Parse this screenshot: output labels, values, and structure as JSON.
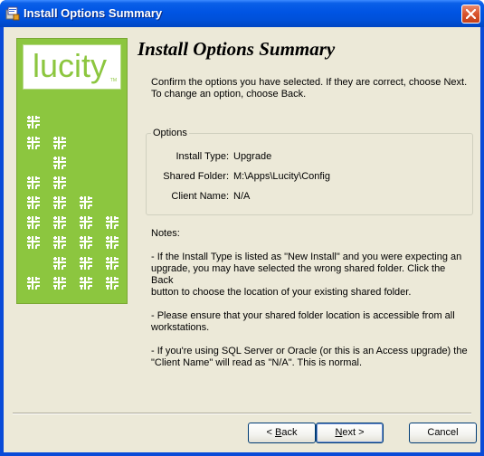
{
  "window": {
    "title": "Install Options Summary",
    "icon": "installer-icon"
  },
  "logo": {
    "text": "lucity",
    "tm": "TM",
    "accent_color": "#8cc63f"
  },
  "heading": "Install Options Summary",
  "intro_line1": "Confirm the options you have selected.  If they are correct, choose Next.",
  "intro_line2": "To change an option, choose Back.",
  "options": {
    "legend": "Options",
    "install_type_label": "Install Type:",
    "install_type_value": "Upgrade",
    "shared_folder_label": "Shared Folder:",
    "shared_folder_value": "M:\\Apps\\Lucity\\Config",
    "client_name_label": "Client Name:",
    "client_name_value": "N/A"
  },
  "notes": {
    "title": "Notes:",
    "note1_l1": " - If the Install Type is listed as \"New Install\" and you were expecting an",
    "note1_l2": "upgrade, you may have selected the wrong shared folder. Click the Back",
    "note1_l3": "button to choose the location of your existing shared folder.",
    "note2_l1": " - Please ensure that your shared folder location is accessible from all",
    "note2_l2": "workstations.",
    "note3_l1": " - If you're using SQL Server or Oracle (or this is an Access upgrade) the",
    "note3_l2": "\"Client Name\" will read as \"N/A\". This is normal."
  },
  "buttons": {
    "back_prefix": "< ",
    "back_key": "B",
    "back_rest": "ack",
    "next_key": "N",
    "next_rest": "ext >",
    "cancel": "Cancel"
  }
}
